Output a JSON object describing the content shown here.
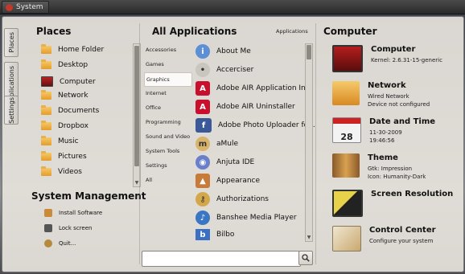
{
  "topbar": {
    "system_label": "System"
  },
  "tabs": {
    "places": "Places",
    "applications": "Applications",
    "settings": "Settings"
  },
  "places": {
    "title": "Places",
    "items": [
      "Home Folder",
      "Desktop",
      "Computer",
      "Network",
      "Documents",
      "Dropbox",
      "Music",
      "Pictures",
      "Videos"
    ]
  },
  "system_management": {
    "title": "System Management",
    "items": [
      "Install Software",
      "Lock screen",
      "Quit..."
    ]
  },
  "applications": {
    "title": "All Applications",
    "header_label": "Applications",
    "categories": [
      "Accessories",
      "Games",
      "Graphics",
      "Internet",
      "Office",
      "Programming",
      "Sound and Video",
      "System Tools",
      "Settings",
      "All"
    ],
    "selected_category": "Graphics",
    "apps": [
      "About Me",
      "Accerciser",
      "Adobe AIR Application In..",
      "Adobe AIR Uninstaller",
      "Adobe Photo Uploader for..",
      "aMule",
      "Anjuta IDE",
      "Appearance",
      "Authorizations",
      "Banshee Media Player",
      "Bilbo"
    ],
    "search_placeholder": ""
  },
  "computer": {
    "title": "Computer",
    "entries": [
      {
        "title": "Computer",
        "lines": [
          "Kernel: 2.6.31-15-generic"
        ],
        "icon": "monitor-icon"
      },
      {
        "title": "Network",
        "lines": [
          "Wired Network",
          "Device not configured"
        ],
        "icon": "network-icon"
      },
      {
        "title": "Date and Time",
        "lines": [
          "11-30-2009",
          "19:46:56"
        ],
        "icon": "calendar-clock-icon"
      },
      {
        "title": "Theme",
        "lines": [
          "Gtk: Impression",
          "Icon: Humanity-Dark"
        ],
        "icon": "theme-icon"
      },
      {
        "title": "Screen Resolution",
        "lines": [],
        "icon": "display-icon"
      },
      {
        "title": "Control Center",
        "lines": [
          "Configure your system"
        ],
        "icon": "control-center-icon"
      }
    ]
  },
  "calendar_icon_day": "28"
}
